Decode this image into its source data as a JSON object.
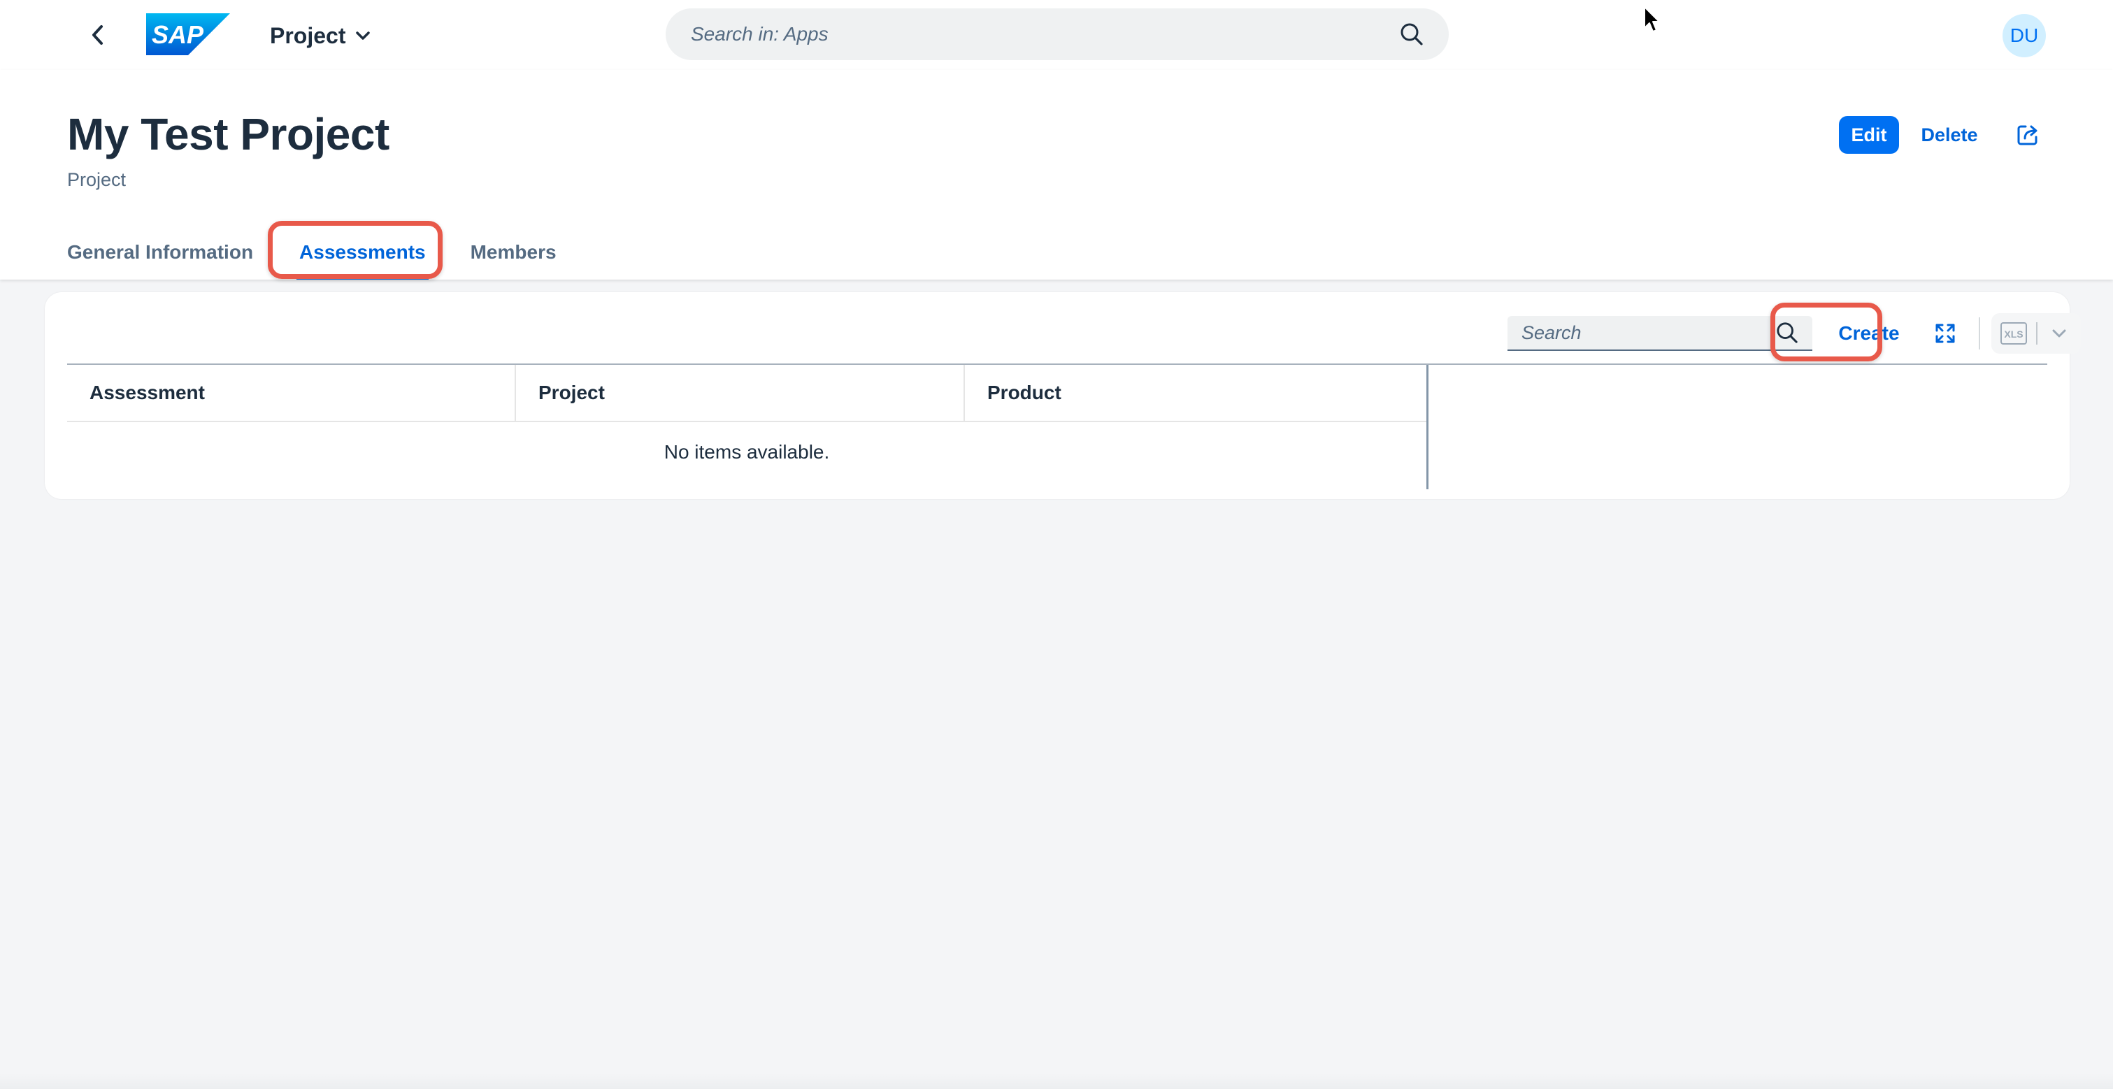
{
  "shell": {
    "app_title": "Project",
    "search_placeholder": "Search in: Apps",
    "avatar_initials": "DU",
    "logo_text": "SAP"
  },
  "header": {
    "title": "My Test Project",
    "subtitle": "Project",
    "actions": {
      "edit": "Edit",
      "delete": "Delete"
    }
  },
  "tabs": [
    {
      "label": "General Information",
      "selected": false
    },
    {
      "label": "Assessments",
      "selected": true
    },
    {
      "label": "Members",
      "selected": false
    }
  ],
  "assessments": {
    "search_placeholder": "Search",
    "create_label": "Create",
    "export_icon_text": "XLS",
    "columns": [
      "Assessment",
      "Project",
      "Product"
    ],
    "no_data_text": "No items available."
  },
  "colors": {
    "brand_blue": "#0070f2",
    "link_blue": "#0064d9",
    "highlight": "#e8594a",
    "text": "#1d2d3e",
    "muted": "#556b82",
    "page_bg": "#f4f5f7"
  },
  "icons": {
    "back": "chevron-left-icon",
    "title_menu": "chevron-down-icon",
    "search": "search-icon",
    "share": "share-icon",
    "fullscreen": "fullscreen-icon",
    "export": "excel-export-icon",
    "export_menu": "chevron-down-icon",
    "pointer": "mouse-pointer-icon"
  }
}
